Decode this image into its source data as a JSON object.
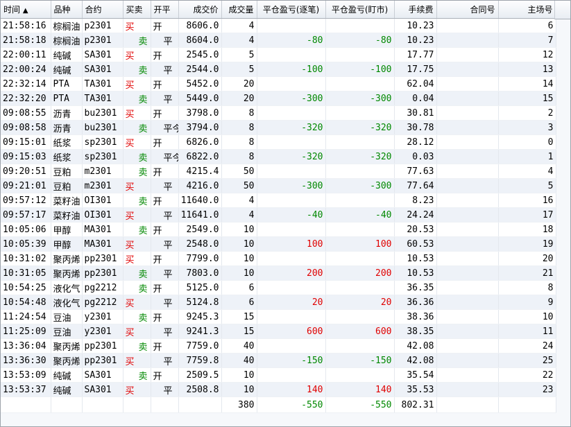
{
  "headers": {
    "time": "时间",
    "sort_arrow": "▲",
    "product": "品种",
    "contract": "合约",
    "direction": "买卖",
    "open_close": "开平",
    "price": "成交价",
    "volume": "成交量",
    "pnl_per_trade": "平仓盈亏(逐笔)",
    "pnl_mark": "平仓盈亏(盯市)",
    "fee": "手续费",
    "contract_no": "合同号",
    "exchange_no": "主场号"
  },
  "rows": [
    {
      "time": "21:58:16",
      "product": "棕榈油",
      "contract": "p2301",
      "side": "买",
      "oc": "开",
      "price": "8606.0",
      "vol": "4",
      "pnl1": "",
      "pnl2": "",
      "fee": "10.23",
      "cno": "",
      "seq": "6"
    },
    {
      "time": "21:58:18",
      "product": "棕榈油",
      "contract": "p2301",
      "side": "卖",
      "oc": "平",
      "price": "8604.0",
      "vol": "4",
      "pnl1": "-80",
      "pnl2": "-80",
      "fee": "10.23",
      "cno": "",
      "seq": "7"
    },
    {
      "time": "22:00:11",
      "product": "纯碱",
      "contract": "SA301",
      "side": "买",
      "oc": "开",
      "price": "2545.0",
      "vol": "5",
      "pnl1": "",
      "pnl2": "",
      "fee": "17.77",
      "cno": "",
      "seq": "12"
    },
    {
      "time": "22:00:24",
      "product": "纯碱",
      "contract": "SA301",
      "side": "卖",
      "oc": "平",
      "price": "2544.0",
      "vol": "5",
      "pnl1": "-100",
      "pnl2": "-100",
      "fee": "17.75",
      "cno": "",
      "seq": "13"
    },
    {
      "time": "22:32:14",
      "product": "PTA",
      "contract": "TA301",
      "side": "买",
      "oc": "开",
      "price": "5452.0",
      "vol": "20",
      "pnl1": "",
      "pnl2": "",
      "fee": "62.04",
      "cno": "",
      "seq": "14"
    },
    {
      "time": "22:32:20",
      "product": "PTA",
      "contract": "TA301",
      "side": "卖",
      "oc": "平",
      "price": "5449.0",
      "vol": "20",
      "pnl1": "-300",
      "pnl2": "-300",
      "fee": "0.04",
      "cno": "",
      "seq": "15"
    },
    {
      "time": "09:08:55",
      "product": "沥青",
      "contract": "bu2301",
      "side": "买",
      "oc": "开",
      "price": "3798.0",
      "vol": "8",
      "pnl1": "",
      "pnl2": "",
      "fee": "30.81",
      "cno": "",
      "seq": "2"
    },
    {
      "time": "09:08:58",
      "product": "沥青",
      "contract": "bu2301",
      "side": "卖",
      "oc": "平今",
      "price": "3794.0",
      "vol": "8",
      "pnl1": "-320",
      "pnl2": "-320",
      "fee": "30.78",
      "cno": "",
      "seq": "3"
    },
    {
      "time": "09:15:01",
      "product": "纸浆",
      "contract": "sp2301",
      "side": "买",
      "oc": "开",
      "price": "6826.0",
      "vol": "8",
      "pnl1": "",
      "pnl2": "",
      "fee": "28.12",
      "cno": "",
      "seq": "0"
    },
    {
      "time": "09:15:03",
      "product": "纸浆",
      "contract": "sp2301",
      "side": "卖",
      "oc": "平今",
      "price": "6822.0",
      "vol": "8",
      "pnl1": "-320",
      "pnl2": "-320",
      "fee": "0.03",
      "cno": "",
      "seq": "1"
    },
    {
      "time": "09:20:51",
      "product": "豆粕",
      "contract": "m2301",
      "side": "卖",
      "oc": "开",
      "price": "4215.4",
      "vol": "50",
      "pnl1": "",
      "pnl2": "",
      "fee": "77.63",
      "cno": "",
      "seq": "4"
    },
    {
      "time": "09:21:01",
      "product": "豆粕",
      "contract": "m2301",
      "side": "买",
      "oc": "平",
      "price": "4216.0",
      "vol": "50",
      "pnl1": "-300",
      "pnl2": "-300",
      "fee": "77.64",
      "cno": "",
      "seq": "5"
    },
    {
      "time": "09:57:12",
      "product": "菜籽油",
      "contract": "OI301",
      "side": "卖",
      "oc": "开",
      "price": "11640.0",
      "vol": "4",
      "pnl1": "",
      "pnl2": "",
      "fee": "8.23",
      "cno": "",
      "seq": "16"
    },
    {
      "time": "09:57:17",
      "product": "菜籽油",
      "contract": "OI301",
      "side": "买",
      "oc": "平",
      "price": "11641.0",
      "vol": "4",
      "pnl1": "-40",
      "pnl2": "-40",
      "fee": "24.24",
      "cno": "",
      "seq": "17"
    },
    {
      "time": "10:05:06",
      "product": "甲醇",
      "contract": "MA301",
      "side": "卖",
      "oc": "开",
      "price": "2549.0",
      "vol": "10",
      "pnl1": "",
      "pnl2": "",
      "fee": "20.53",
      "cno": "",
      "seq": "18"
    },
    {
      "time": "10:05:39",
      "product": "甲醇",
      "contract": "MA301",
      "side": "买",
      "oc": "平",
      "price": "2548.0",
      "vol": "10",
      "pnl1": "100",
      "pnl2": "100",
      "fee": "60.53",
      "cno": "",
      "seq": "19"
    },
    {
      "time": "10:31:02",
      "product": "聚丙烯",
      "contract": "pp2301",
      "side": "买",
      "oc": "开",
      "price": "7799.0",
      "vol": "10",
      "pnl1": "",
      "pnl2": "",
      "fee": "10.53",
      "cno": "",
      "seq": "20"
    },
    {
      "time": "10:31:05",
      "product": "聚丙烯",
      "contract": "pp2301",
      "side": "卖",
      "oc": "平",
      "price": "7803.0",
      "vol": "10",
      "pnl1": "200",
      "pnl2": "200",
      "fee": "10.53",
      "cno": "",
      "seq": "21"
    },
    {
      "time": "10:54:25",
      "product": "液化气",
      "contract": "pg2212",
      "side": "卖",
      "oc": "开",
      "price": "5125.0",
      "vol": "6",
      "pnl1": "",
      "pnl2": "",
      "fee": "36.35",
      "cno": "",
      "seq": "8"
    },
    {
      "time": "10:54:48",
      "product": "液化气",
      "contract": "pg2212",
      "side": "买",
      "oc": "平",
      "price": "5124.8",
      "vol": "6",
      "pnl1": "20",
      "pnl2": "20",
      "fee": "36.36",
      "cno": "",
      "seq": "9"
    },
    {
      "time": "11:24:54",
      "product": "豆油",
      "contract": "y2301",
      "side": "卖",
      "oc": "开",
      "price": "9245.3",
      "vol": "15",
      "pnl1": "",
      "pnl2": "",
      "fee": "38.36",
      "cno": "",
      "seq": "10"
    },
    {
      "time": "11:25:09",
      "product": "豆油",
      "contract": "y2301",
      "side": "买",
      "oc": "平",
      "price": "9241.3",
      "vol": "15",
      "pnl1": "600",
      "pnl2": "600",
      "fee": "38.35",
      "cno": "",
      "seq": "11"
    },
    {
      "time": "13:36:04",
      "product": "聚丙烯",
      "contract": "pp2301",
      "side": "卖",
      "oc": "开",
      "price": "7759.0",
      "vol": "40",
      "pnl1": "",
      "pnl2": "",
      "fee": "42.08",
      "cno": "",
      "seq": "24"
    },
    {
      "time": "13:36:30",
      "product": "聚丙烯",
      "contract": "pp2301",
      "side": "买",
      "oc": "平",
      "price": "7759.8",
      "vol": "40",
      "pnl1": "-150",
      "pnl2": "-150",
      "fee": "42.08",
      "cno": "",
      "seq": "25"
    },
    {
      "time": "13:53:09",
      "product": "纯碱",
      "contract": "SA301",
      "side": "卖",
      "oc": "开",
      "price": "2509.5",
      "vol": "10",
      "pnl1": "",
      "pnl2": "",
      "fee": "35.54",
      "cno": "",
      "seq": "22"
    },
    {
      "time": "13:53:37",
      "product": "纯碱",
      "contract": "SA301",
      "side": "买",
      "oc": "平",
      "price": "2508.8",
      "vol": "10",
      "pnl1": "140",
      "pnl2": "140",
      "fee": "35.53",
      "cno": "",
      "seq": "23"
    }
  ],
  "totals": {
    "vol": "380",
    "pnl1": "-550",
    "pnl2": "-550",
    "fee": "802.31"
  },
  "colors": {
    "buy": "#e00000",
    "sell": "#008800",
    "profit": "#e00000",
    "loss": "#008800"
  }
}
